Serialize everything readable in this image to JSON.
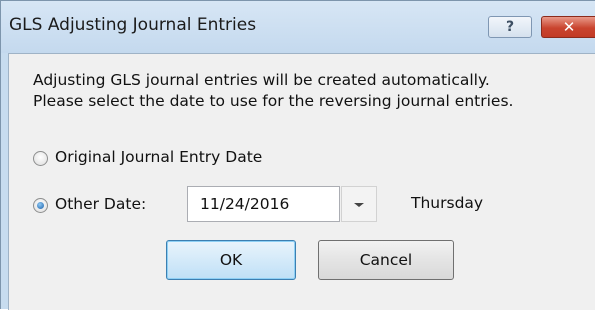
{
  "window": {
    "title": "GLS Adjusting Journal Entries"
  },
  "titlebar": {
    "help_label": "?",
    "close_label": "✕"
  },
  "message": {
    "line1": "Adjusting GLS journal entries will be created automatically.",
    "line2": "Please select the date to use for the reversing journal entries."
  },
  "options": {
    "original_label": "Original Journal Entry Date",
    "original_checked": false,
    "other_label": "Other Date:",
    "other_checked": true
  },
  "date": {
    "value": "11/24/2016",
    "weekday": "Thursday"
  },
  "buttons": {
    "ok_label": "OK",
    "cancel_label": "Cancel"
  },
  "colors": {
    "title_bar": "#c4d9ee",
    "close_button": "#c9442f",
    "dialog_background": "#f0f0f0",
    "default_button_border": "#3c7fb1"
  },
  "icons": {
    "help": "help-icon",
    "close": "close-icon",
    "dropdown": "chevron-down-icon"
  }
}
